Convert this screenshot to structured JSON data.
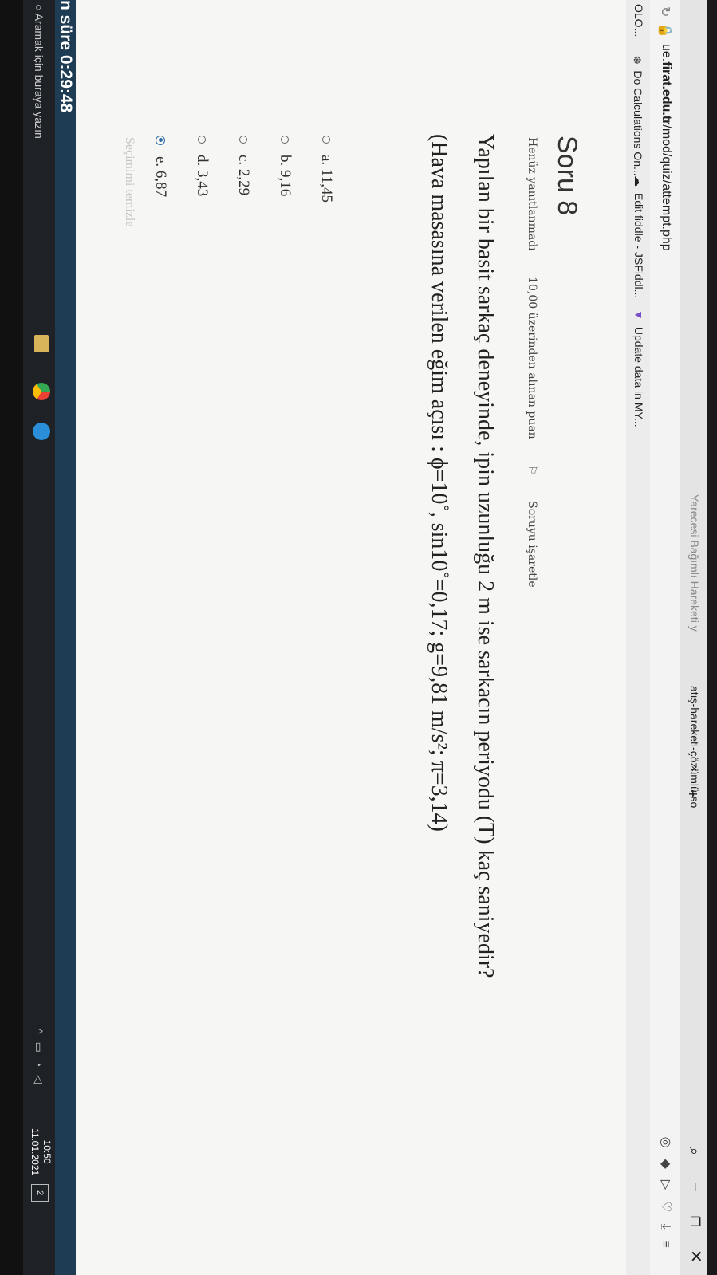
{
  "browser": {
    "tab_partial": "Yarecesi Bağımlı Hareketi y",
    "tab_active": "atış-hareketi-çözümlü-so",
    "tab_close": "×",
    "tab_new": "+",
    "url_prefix": "ue.",
    "url_domain": "firat.edu.tr",
    "url_path": "/mod/quiz/attempt.php",
    "bookmarks": [
      "OLO...",
      "Do Calculations On...",
      "Edit fiddle - JSFiddl...",
      "Update data in MY..."
    ]
  },
  "quiz": {
    "title": "Soru 8",
    "status": "Henüz yanıtlanmadı",
    "points": "10,00 üzerinden alınan puan",
    "flag_label": "Soruyu işaretle",
    "question_line1": "Yapılan bir basit sarkaç deneyinde, ipin uzunluğu 2 m ise sarkacın periyodu (T) kaç saniyedir?",
    "question_line2": "(Hava masasına verilen eğim açısı : ϕ=10˚, sin10˚=0,17; g=9,81 m/s²; π=3,14)",
    "options": [
      {
        "label": "a. 11,45",
        "selected": false
      },
      {
        "label": "b. 9,16",
        "selected": false
      },
      {
        "label": "c. 2,29",
        "selected": false
      },
      {
        "label": "d. 3,43",
        "selected": false
      },
      {
        "label": "e. 6,87",
        "selected": true
      }
    ],
    "clear_choice": "Seçimimi temizle",
    "timer": "n süre 0:29:48"
  },
  "taskbar": {
    "search": "Aramak için buraya yazın",
    "time": "10:50",
    "date": "11.01.2021",
    "notifications": "2"
  },
  "colors": {
    "accent": "#2d6ca8",
    "timer_bg": "#1f3c55",
    "page_bg": "#f6f6f4"
  }
}
